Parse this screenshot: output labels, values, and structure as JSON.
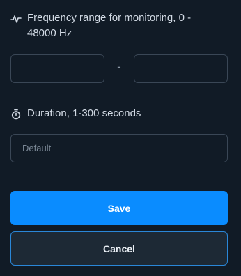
{
  "frequency": {
    "label": "Frequency range for monitoring, 0 - 48000 Hz",
    "icon": "waveform-icon",
    "min_value": "",
    "max_value": "",
    "separator": "-"
  },
  "duration": {
    "label": "Duration, 1-300 seconds",
    "icon": "stopwatch-icon",
    "value": "",
    "placeholder": "Default"
  },
  "actions": {
    "save_label": "Save",
    "cancel_label": "Cancel"
  },
  "colors": {
    "background": "#111b26",
    "primary": "#0a8cff",
    "cancel_border": "#2a87d8"
  }
}
